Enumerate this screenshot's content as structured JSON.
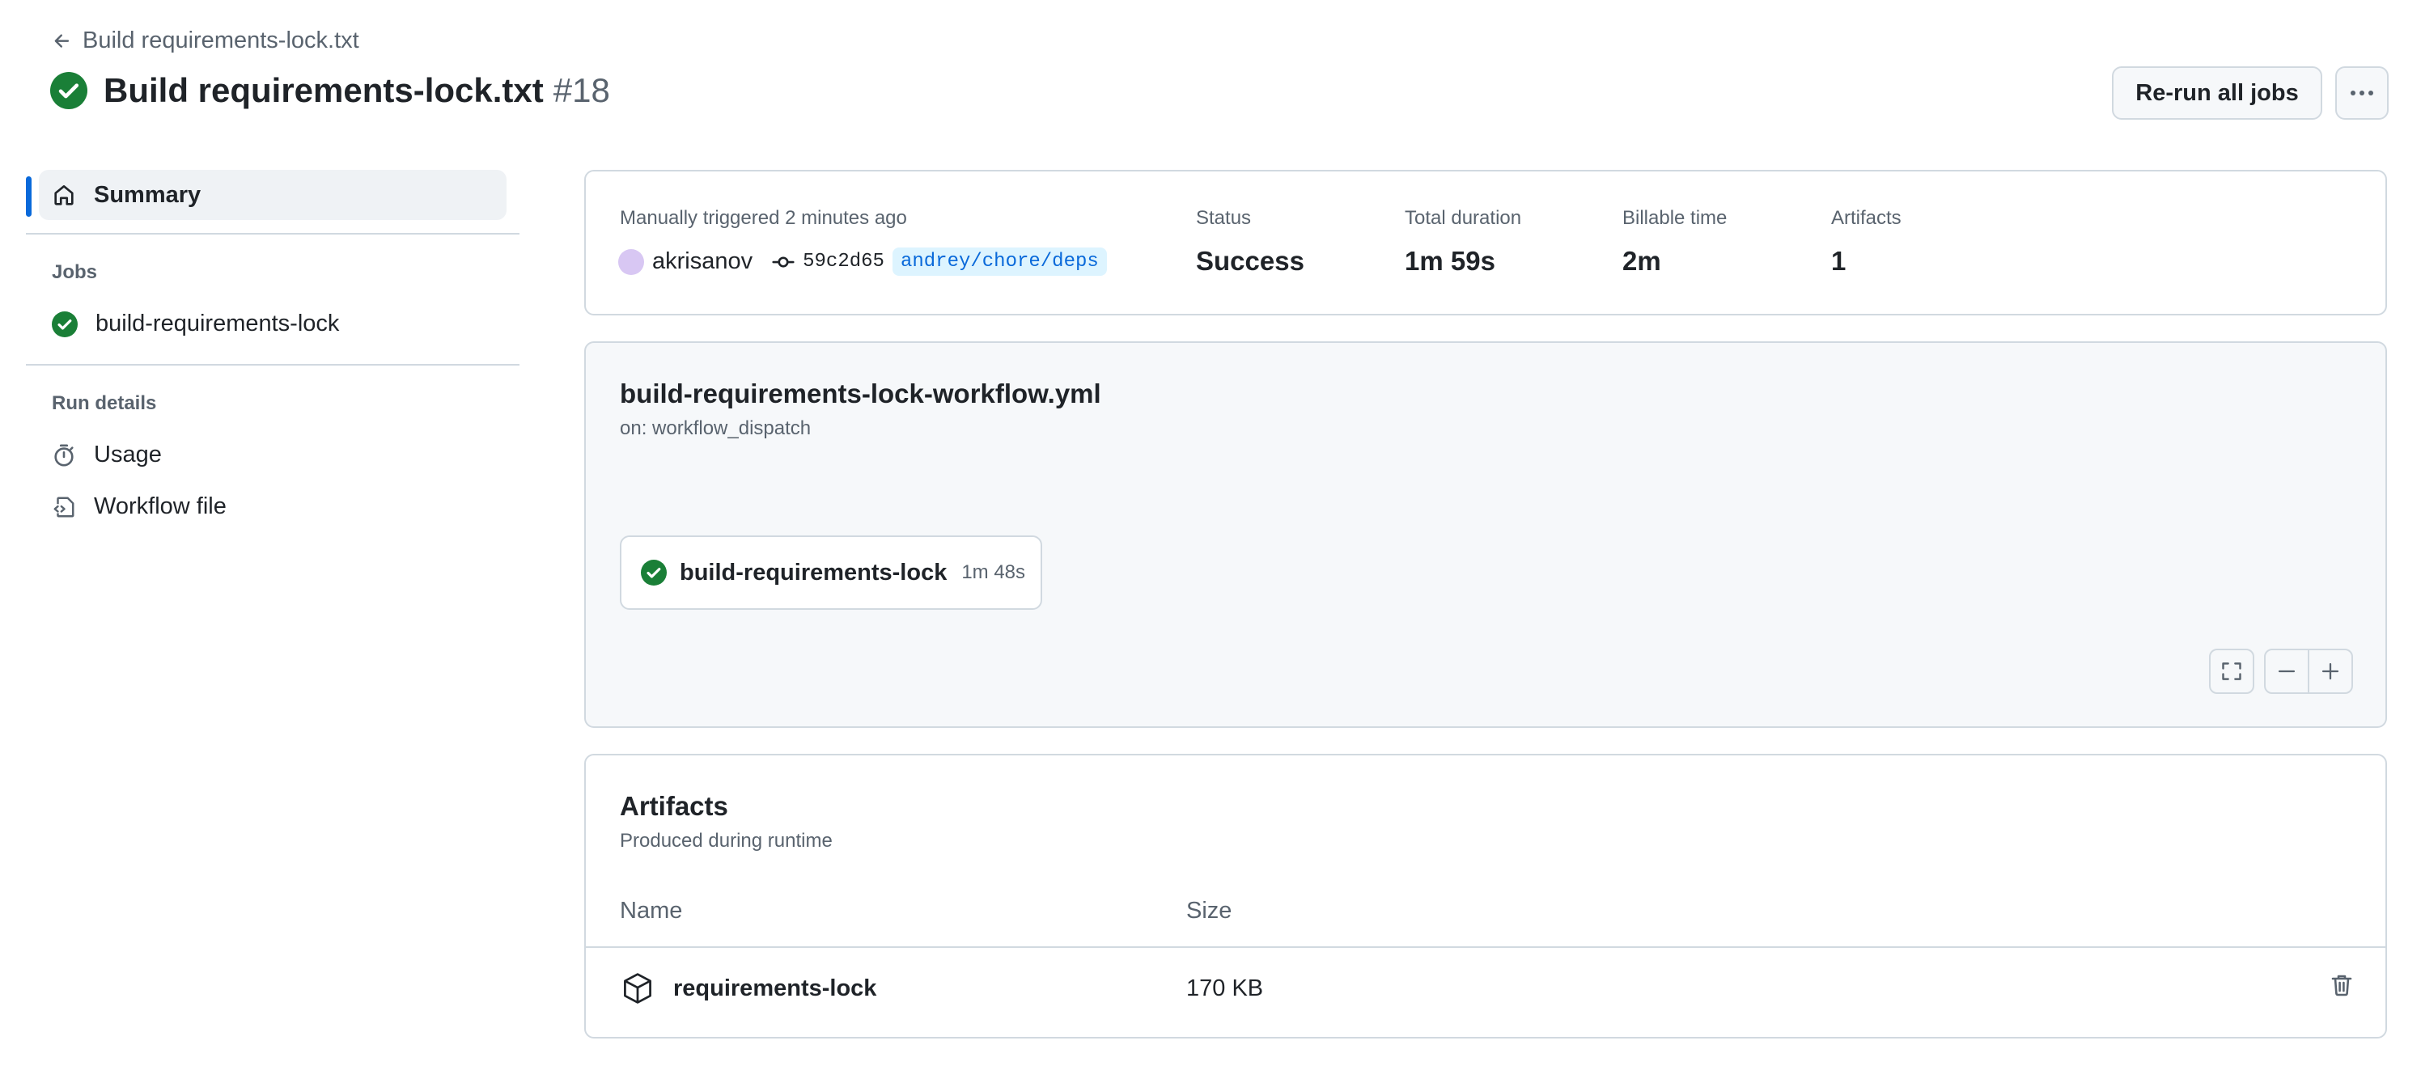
{
  "header": {
    "back_label": "Build requirements-lock.txt",
    "title": "Build requirements-lock.txt",
    "run_number": "#18",
    "rerun_label": "Re-run all jobs",
    "status_color": "#1a7f37"
  },
  "sidebar": {
    "summary_label": "Summary",
    "jobs_heading": "Jobs",
    "jobs": [
      {
        "label": "build-requirements-lock",
        "status": "success"
      }
    ],
    "run_details_heading": "Run details",
    "usage_label": "Usage",
    "workflow_file_label": "Workflow file"
  },
  "summary": {
    "trigger_text": "Manually triggered 2 minutes ago",
    "actor": "akrisanov",
    "commit": "59c2d65",
    "branch": "andrey/chore/deps",
    "status_label": "Status",
    "status_value": "Success",
    "duration_label": "Total duration",
    "duration_value": "1m 59s",
    "billable_label": "Billable time",
    "billable_value": "2m",
    "artifacts_label": "Artifacts",
    "artifacts_value": "1"
  },
  "graph": {
    "workflow_name": "build-requirements-lock-workflow.yml",
    "trigger": "on: workflow_dispatch",
    "job": {
      "name": "build-requirements-lock",
      "duration": "1m 48s"
    }
  },
  "artifacts": {
    "title": "Artifacts",
    "subtitle": "Produced during runtime",
    "columns": {
      "name": "Name",
      "size": "Size"
    },
    "rows": [
      {
        "name": "requirements-lock",
        "size": "170 KB"
      }
    ]
  }
}
